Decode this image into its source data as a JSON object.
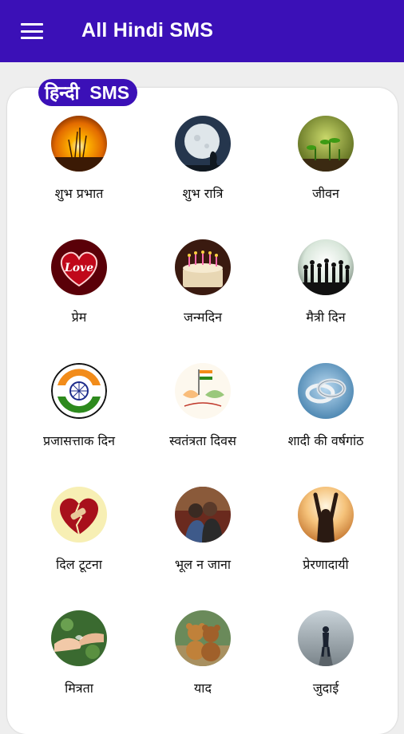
{
  "appbar": {
    "title": "All Hindi SMS",
    "menu_icon": "hamburger-menu-icon"
  },
  "header_badge": "हिन्दी  SMS",
  "categories": [
    {
      "label": "शुभ प्रभात",
      "icon": "sunrise-image"
    },
    {
      "label": "शुभ रात्रि",
      "icon": "moon-night-image"
    },
    {
      "label": "जीवन",
      "icon": "plant-sprout-image"
    },
    {
      "label": "प्रेम",
      "icon": "love-heart-image",
      "text": "Love"
    },
    {
      "label": "जन्मदिन",
      "icon": "birthday-cake-image"
    },
    {
      "label": "मैत्री दिन",
      "icon": "friends-silhouette-image"
    },
    {
      "label": "प्रजासत्ताक दिन",
      "icon": "ashoka-chakra-flag-image"
    },
    {
      "label": "स्वतंत्रता दिवस",
      "icon": "independence-day-flag-image"
    },
    {
      "label": "शादी की वर्षगांठ",
      "icon": "wedding-rings-image"
    },
    {
      "label": "दिल टूटना",
      "icon": "broken-heart-image"
    },
    {
      "label": "भूल न जाना",
      "icon": "couple-image"
    },
    {
      "label": "प्रेरणादायी",
      "icon": "raised-arms-person-image"
    },
    {
      "label": "मित्रता",
      "icon": "holding-hands-image"
    },
    {
      "label": "याद",
      "icon": "teddy-bears-image"
    },
    {
      "label": "जुदाई",
      "icon": "lonely-person-road-image"
    }
  ],
  "colors": {
    "appbar": "#3b10b7",
    "background": "#eeeeee",
    "card": "#ffffff"
  }
}
